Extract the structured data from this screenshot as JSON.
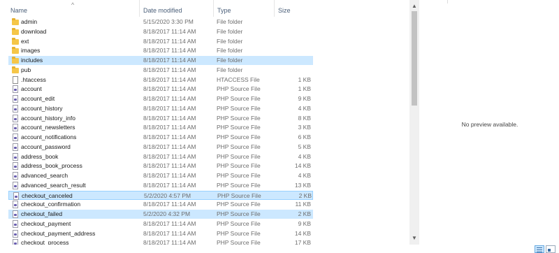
{
  "columns": {
    "name": "Name",
    "date": "Date modified",
    "type": "Type",
    "size": "Size",
    "sort_indicator": "^"
  },
  "files": [
    {
      "name": "admin",
      "date": "5/15/2020 3:30 PM",
      "type": "File folder",
      "size": "",
      "icon": "folder-icon",
      "state": ""
    },
    {
      "name": "download",
      "date": "8/18/2017 11:14 AM",
      "type": "File folder",
      "size": "",
      "icon": "folder-icon",
      "state": ""
    },
    {
      "name": "ext",
      "date": "8/18/2017 11:14 AM",
      "type": "File folder",
      "size": "",
      "icon": "folder-icon",
      "state": ""
    },
    {
      "name": "images",
      "date": "8/18/2017 11:14 AM",
      "type": "File folder",
      "size": "",
      "icon": "folder-icon",
      "state": ""
    },
    {
      "name": "includes",
      "date": "8/18/2017 11:14 AM",
      "type": "File folder",
      "size": "",
      "icon": "folder-icon",
      "state": "selected"
    },
    {
      "name": "pub",
      "date": "8/18/2017 11:14 AM",
      "type": "File folder",
      "size": "",
      "icon": "folder-icon",
      "state": ""
    },
    {
      "name": ".htaccess",
      "date": "8/18/2017 11:14 AM",
      "type": "HTACCESS File",
      "size": "1 KB",
      "icon": "file-icon",
      "state": ""
    },
    {
      "name": "account",
      "date": "8/18/2017 11:14 AM",
      "type": "PHP Source File",
      "size": "1 KB",
      "icon": "php-file-icon",
      "state": ""
    },
    {
      "name": "account_edit",
      "date": "8/18/2017 11:14 AM",
      "type": "PHP Source File",
      "size": "9 KB",
      "icon": "php-file-icon",
      "state": ""
    },
    {
      "name": "account_history",
      "date": "8/18/2017 11:14 AM",
      "type": "PHP Source File",
      "size": "4 KB",
      "icon": "php-file-icon",
      "state": ""
    },
    {
      "name": "account_history_info",
      "date": "8/18/2017 11:14 AM",
      "type": "PHP Source File",
      "size": "8 KB",
      "icon": "php-file-icon",
      "state": ""
    },
    {
      "name": "account_newsletters",
      "date": "8/18/2017 11:14 AM",
      "type": "PHP Source File",
      "size": "3 KB",
      "icon": "php-file-icon",
      "state": ""
    },
    {
      "name": "account_notifications",
      "date": "8/18/2017 11:14 AM",
      "type": "PHP Source File",
      "size": "6 KB",
      "icon": "php-file-icon",
      "state": ""
    },
    {
      "name": "account_password",
      "date": "8/18/2017 11:14 AM",
      "type": "PHP Source File",
      "size": "5 KB",
      "icon": "php-file-icon",
      "state": ""
    },
    {
      "name": "address_book",
      "date": "8/18/2017 11:14 AM",
      "type": "PHP Source File",
      "size": "4 KB",
      "icon": "php-file-icon",
      "state": ""
    },
    {
      "name": "address_book_process",
      "date": "8/18/2017 11:14 AM",
      "type": "PHP Source File",
      "size": "14 KB",
      "icon": "php-file-icon",
      "state": ""
    },
    {
      "name": "advanced_search",
      "date": "8/18/2017 11:14 AM",
      "type": "PHP Source File",
      "size": "4 KB",
      "icon": "php-file-icon",
      "state": ""
    },
    {
      "name": "advanced_search_result",
      "date": "8/18/2017 11:14 AM",
      "type": "PHP Source File",
      "size": "13 KB",
      "icon": "php-file-icon",
      "state": ""
    },
    {
      "name": "checkout_canceled",
      "date": "5/2/2020 4:57 PM",
      "type": "PHP Source File",
      "size": "2 KB",
      "icon": "php-file-icon",
      "state": "selected-border"
    },
    {
      "name": "checkout_confirmation",
      "date": "8/18/2017 11:14 AM",
      "type": "PHP Source File",
      "size": "11 KB",
      "icon": "php-file-icon",
      "state": ""
    },
    {
      "name": "checkout_failed",
      "date": "5/2/2020 4:32 PM",
      "type": "PHP Source File",
      "size": "2 KB",
      "icon": "php-file-icon",
      "state": "selected"
    },
    {
      "name": "checkout_payment",
      "date": "8/18/2017 11:14 AM",
      "type": "PHP Source File",
      "size": "9 KB",
      "icon": "php-file-icon",
      "state": ""
    },
    {
      "name": "checkout_payment_address",
      "date": "8/18/2017 11:14 AM",
      "type": "PHP Source File",
      "size": "14 KB",
      "icon": "php-file-icon",
      "state": ""
    },
    {
      "name": "checkout_process",
      "date": "8/18/2017 11:14 AM",
      "type": "PHP Source File",
      "size": "17 KB",
      "icon": "php-file-icon",
      "state": ""
    }
  ],
  "preview": {
    "message": "No preview available."
  },
  "colors": {
    "selection": "#cce8ff",
    "selection_border": "#99d1ff",
    "header_text": "#4c607a",
    "folder": "#f5c648"
  }
}
